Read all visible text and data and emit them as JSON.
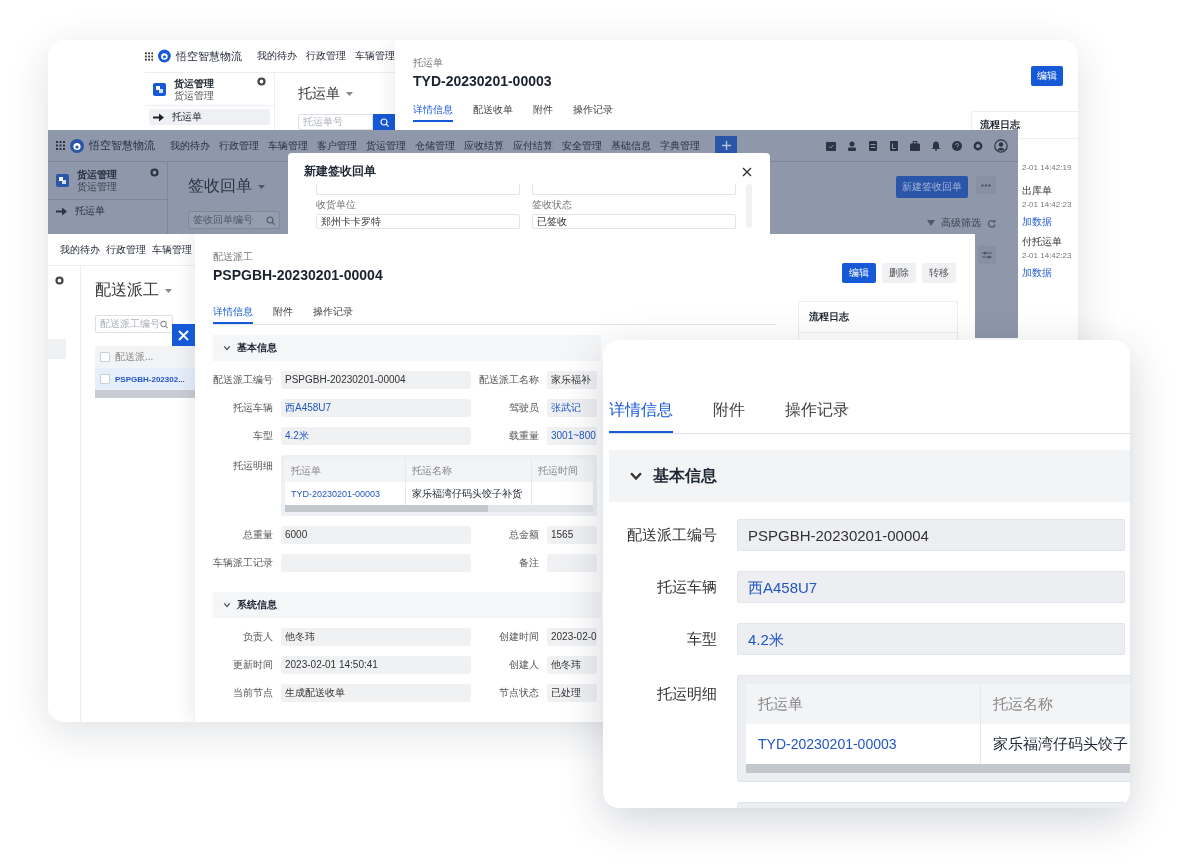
{
  "back_window": {
    "app": {
      "brand": "悟空智慧物流",
      "nav": [
        "我的待办",
        "行政管理",
        "车辆管理"
      ],
      "module": {
        "title": "货运管理",
        "subtitle": "货运管理"
      },
      "sidebar_items": [
        {
          "label": "托运单",
          "selected": true
        }
      ],
      "page_title": "托运单",
      "search": {
        "placeholder": "托运单号"
      }
    },
    "detail": {
      "breadcrumb": "托运单",
      "title": "TYD-20230201-00003",
      "buttons": [
        {
          "label": "编辑",
          "kind": "primary"
        }
      ],
      "tabs": [
        {
          "label": "详情信息",
          "selected": true
        },
        {
          "label": "配送收单",
          "selected": false
        },
        {
          "label": "附件",
          "selected": false
        },
        {
          "label": "操作记录",
          "selected": false
        }
      ],
      "log": {
        "title": "流程日志",
        "entries": [
          {
            "kind": "time",
            "text": "2-01 14:42:19"
          },
          {
            "kind": "title",
            "text": "出库单"
          },
          {
            "kind": "time",
            "text": "2-01 14:42:23"
          },
          {
            "kind": "link",
            "text": "加数据"
          },
          {
            "kind": "title",
            "text": "付托运单"
          },
          {
            "kind": "time",
            "text": "2-01 14:42:23"
          },
          {
            "kind": "link",
            "text": "加数据"
          }
        ]
      }
    }
  },
  "middle_window": {
    "brand": "悟空智慧物流",
    "nav": [
      "我的待办",
      "行政管理",
      "车辆管理",
      "客户管理",
      "货运管理",
      "仓储管理",
      "应收结算",
      "应付结算",
      "安全管理",
      "基础信息",
      "字典管理"
    ],
    "module": {
      "title": "货运管理",
      "subtitle": "货运管理"
    },
    "sidebar_items": [
      {
        "label": "托运单",
        "selected": false
      }
    ],
    "page_title": "签收回单",
    "search": {
      "placeholder": "签收回单编号"
    },
    "actions": [
      {
        "kind": "primary",
        "label": "新建签收回单"
      },
      {
        "kind": "more"
      }
    ],
    "filter": "高级筛选"
  },
  "dialog": {
    "title": "新建签收回单",
    "fields": [
      {
        "label": "收货单位",
        "value": "郑州卡卡罗特"
      },
      {
        "label": "签收状态",
        "value": "已签收"
      }
    ]
  },
  "front_window": {
    "nav": [
      "我的待办",
      "行政管理",
      "车辆管理"
    ],
    "sidebar_items": [
      {
        "selected": true
      }
    ],
    "page_title": "配送派工",
    "search": {
      "placeholder": "配送派工编号"
    },
    "list": {
      "select_all_checked": false,
      "columns": [
        "配送派..."
      ],
      "rows": [
        {
          "number": "PSPGBH-202302...",
          "selected": true,
          "checked": false
        }
      ]
    },
    "detail": {
      "breadcrumb": "配送派工",
      "title": "PSPGBH-20230201-00004",
      "buttons": [
        {
          "label": "编辑",
          "kind": "primary"
        },
        {
          "label": "删除",
          "kind": "default"
        },
        {
          "label": "转移",
          "kind": "default"
        }
      ],
      "tabs": [
        {
          "label": "详情信息",
          "selected": true
        },
        {
          "label": "附件",
          "selected": false
        },
        {
          "label": "操作记录",
          "selected": false
        }
      ],
      "log": {
        "title": "流程日志"
      },
      "sections": [
        {
          "title": "基本信息",
          "expanded": true,
          "fields": [
            {
              "kind": "field",
              "label": "配送派工编号",
              "value": "PSPGBH-20230201-00004",
              "link": false
            },
            {
              "kind": "field",
              "label": "配送派工名称",
              "value": "家乐福补",
              "link": false
            },
            {
              "kind": "field",
              "label": "托运车辆",
              "value": "西A458U7",
              "link": true
            },
            {
              "kind": "field",
              "label": "驾驶员",
              "value": "张武记",
              "link": true
            },
            {
              "kind": "field",
              "label": "车型",
              "value": "4.2米",
              "link": true
            },
            {
              "kind": "field",
              "label": "载重量",
              "value": "3001~800",
              "link": true
            },
            {
              "kind": "table",
              "label": "托运明细",
              "columns": [
                "托运单",
                "托运名称",
                "托运时间"
              ],
              "rows": [
                {
                  "order": "TYD-20230201-00003",
                  "name": "家乐福湾仔码头饺子补货"
                }
              ]
            },
            {
              "kind": "field",
              "label": "总重量",
              "value": "6000",
              "link": false
            },
            {
              "kind": "field",
              "label": "总金额",
              "value": "1565",
              "link": false
            },
            {
              "kind": "field",
              "label": "车辆派工记录",
              "link": false
            },
            {
              "kind": "field",
              "label": "备注",
              "link": false
            }
          ]
        },
        {
          "title": "系统信息",
          "expanded": true,
          "fields": [
            {
              "kind": "field",
              "label": "负责人",
              "value": "他冬玮",
              "link": false
            },
            {
              "kind": "field",
              "label": "创建时间",
              "value": "2023-02-0",
              "link": false
            },
            {
              "kind": "field",
              "label": "更新时间",
              "value": "2023-02-01 14:50:41",
              "link": false
            },
            {
              "kind": "field",
              "label": "创建人",
              "value": "他冬玮",
              "link": false
            },
            {
              "kind": "field",
              "label": "当前节点",
              "value": "生成配送收单",
              "link": false
            },
            {
              "kind": "field",
              "label": "节点状态",
              "value": "已处理",
              "link": false
            }
          ]
        }
      ]
    }
  },
  "zoom_card": {
    "tabs": [
      {
        "label": "详情信息",
        "selected": true
      },
      {
        "label": "附件",
        "selected": false
      },
      {
        "label": "操作记录",
        "selected": false
      }
    ],
    "section": {
      "title": "基本信息",
      "expanded": true
    },
    "fields": [
      {
        "kind": "field",
        "label": "配送派工编号",
        "value": "PSPGBH-20230201-00004",
        "link": false
      },
      {
        "kind": "field",
        "label": "托运车辆",
        "value": "西A458U7",
        "link": true
      },
      {
        "kind": "field",
        "label": "车型",
        "value": "4.2米",
        "link": true
      },
      {
        "kind": "table",
        "label": "托运明细",
        "columns": [
          "托运单",
          "托运名称"
        ],
        "rows": [
          {
            "order": "TYD-20230201-00003",
            "name": "家乐福湾仔码头饺子"
          }
        ]
      },
      {
        "kind": "field"
      }
    ]
  }
}
